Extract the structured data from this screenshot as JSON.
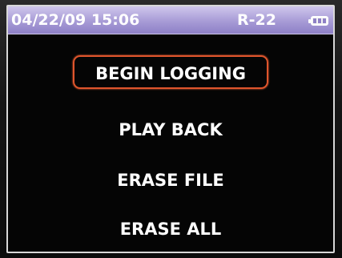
{
  "status_bar": {
    "datetime": "04/22/09 15:06",
    "refrigerant": "R-22",
    "battery_icon": "battery-icon"
  },
  "menu": {
    "items": [
      {
        "label": "BEGIN LOGGING",
        "selected": true
      },
      {
        "label": "PLAY BACK",
        "selected": false
      },
      {
        "label": "ERASE FILE",
        "selected": false
      },
      {
        "label": "ERASE ALL",
        "selected": false
      }
    ]
  },
  "colors": {
    "status_bar": "#a79bd6",
    "selection_border": "#e0552c",
    "screen_background": "#050505",
    "text": "#ffffff"
  }
}
